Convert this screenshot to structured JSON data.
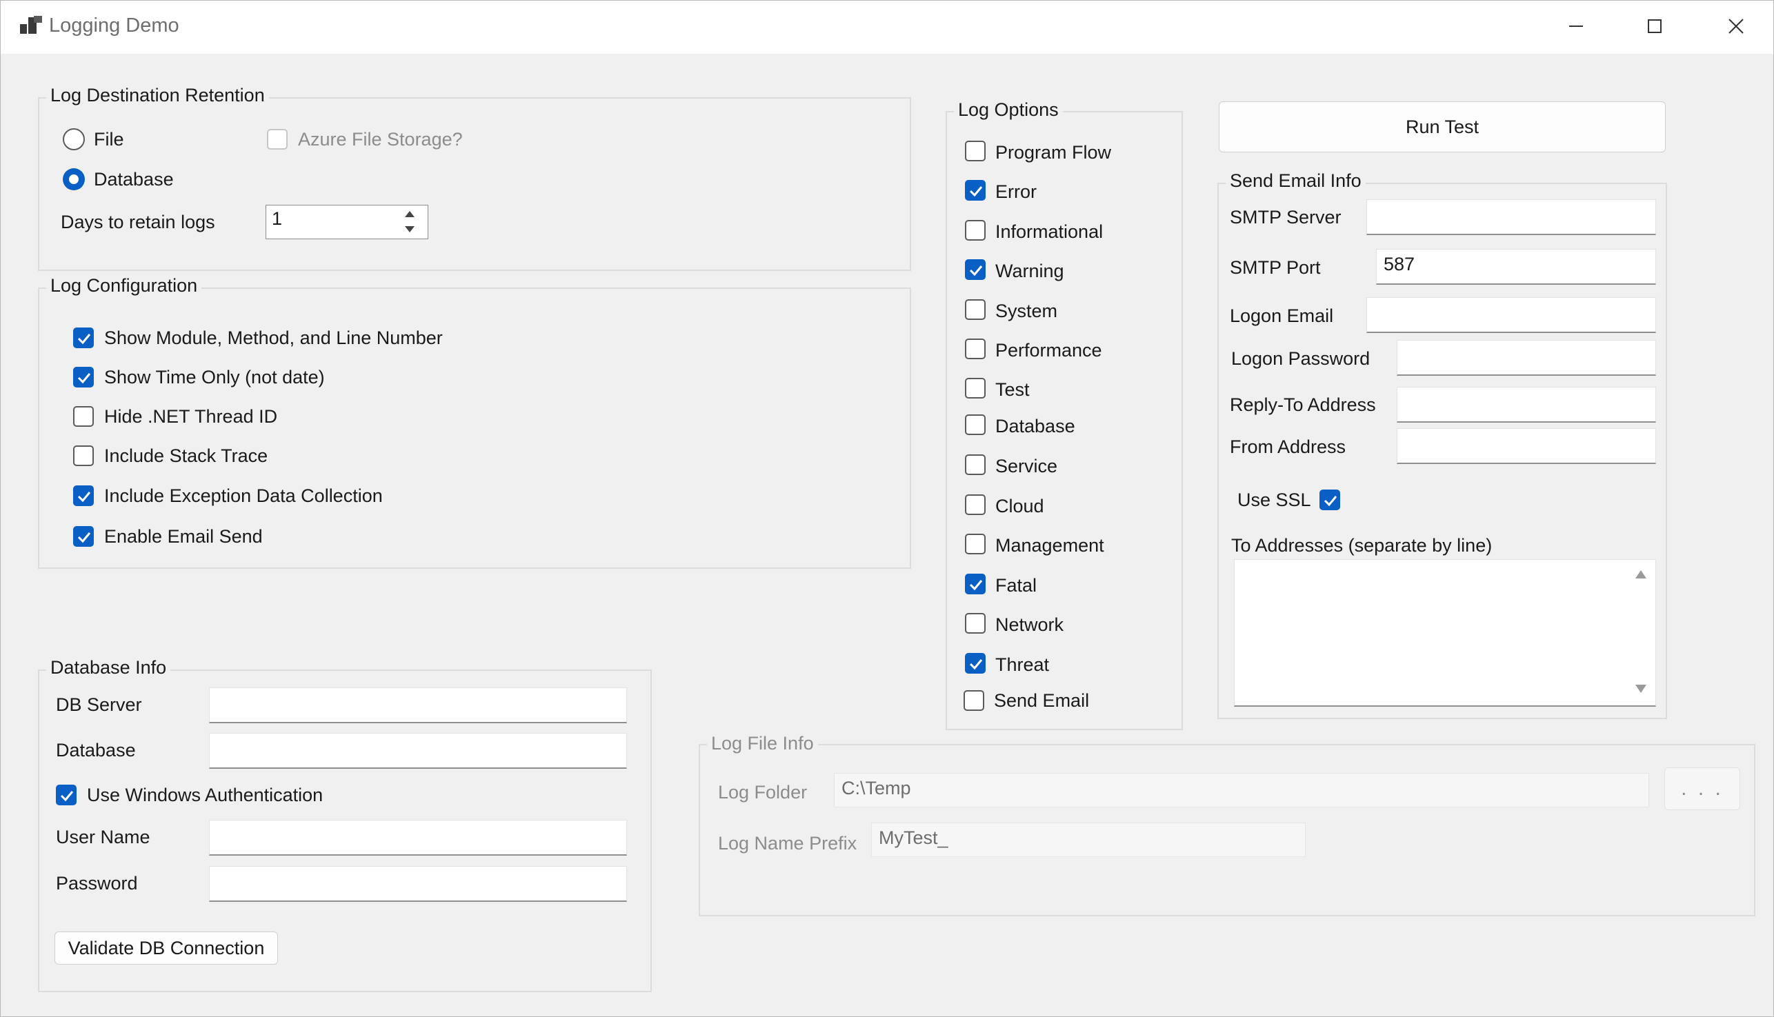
{
  "window": {
    "title": "Logging Demo"
  },
  "log_destination": {
    "legend": "Log Destination  Retention",
    "file_label": "File",
    "database_label": "Database",
    "selected": "Database",
    "azure_label": "Azure File Storage?",
    "days_label": "Days to retain logs",
    "days_value": "1"
  },
  "log_configuration": {
    "legend": "Log Configuration",
    "items": [
      {
        "label": "Show Module, Method, and Line Number",
        "checked": true
      },
      {
        "label": "Show Time Only (not date)",
        "checked": true
      },
      {
        "label": "Hide .NET Thread ID",
        "checked": false
      },
      {
        "label": "Include Stack Trace",
        "checked": false
      },
      {
        "label": "Include Exception Data Collection",
        "checked": true
      },
      {
        "label": "Enable Email Send",
        "checked": true
      }
    ]
  },
  "log_options": {
    "legend": "Log Options",
    "items": [
      {
        "label": "Program Flow",
        "checked": false
      },
      {
        "label": "Error",
        "checked": true
      },
      {
        "label": "Informational",
        "checked": false
      },
      {
        "label": "Warning",
        "checked": true
      },
      {
        "label": "System",
        "checked": false
      },
      {
        "label": "Performance",
        "checked": false
      },
      {
        "label": "Test",
        "checked": false
      },
      {
        "label": "Database",
        "checked": false
      },
      {
        "label": "Service",
        "checked": false
      },
      {
        "label": "Cloud",
        "checked": false
      },
      {
        "label": "Management",
        "checked": false
      },
      {
        "label": "Fatal",
        "checked": true
      },
      {
        "label": "Network",
        "checked": false
      },
      {
        "label": "Threat",
        "checked": true
      },
      {
        "label": "Send Email",
        "checked": false
      }
    ]
  },
  "run_test_label": "Run Test",
  "send_email": {
    "legend": "Send Email Info",
    "smtp_server_label": "SMTP Server",
    "smtp_server_value": "",
    "smtp_port_label": "SMTP Port",
    "smtp_port_value": "587",
    "logon_email_label": "Logon Email",
    "logon_email_value": "",
    "logon_password_label": "Logon Password",
    "logon_password_value": "",
    "reply_to_label": "Reply-To Address",
    "reply_to_value": "",
    "from_label": "From Address",
    "from_value": "",
    "use_ssl_label": "Use SSL",
    "use_ssl_checked": true,
    "to_addresses_label": "To Addresses (separate by line)",
    "to_addresses_value": ""
  },
  "database_info": {
    "legend": "Database Info",
    "db_server_label": "DB Server",
    "db_server_value": "",
    "database_label": "Database",
    "database_value": "",
    "windows_auth_label": "Use Windows Authentication",
    "windows_auth_checked": true,
    "username_label": "User Name",
    "username_value": "",
    "password_label": "Password",
    "password_value": "",
    "validate_label": "Validate DB Connection"
  },
  "log_file_info": {
    "legend": "Log File Info",
    "folder_label": "Log Folder",
    "folder_value": "C:\\Temp",
    "browse_label": ". . .",
    "prefix_label": "Log Name Prefix",
    "prefix_value": "MyTest_"
  },
  "icons": {
    "app": "app-icon",
    "minimize": "minimize-icon",
    "maximize": "maximize-icon",
    "close": "close-icon",
    "checkmark": "checkmark-icon",
    "spin_up": "up-arrow-icon",
    "spin_down": "down-arrow-icon"
  },
  "colors": {
    "accent": "#0a5fc4",
    "titlebar": "#ffffff",
    "background": "#f0f0f0"
  }
}
